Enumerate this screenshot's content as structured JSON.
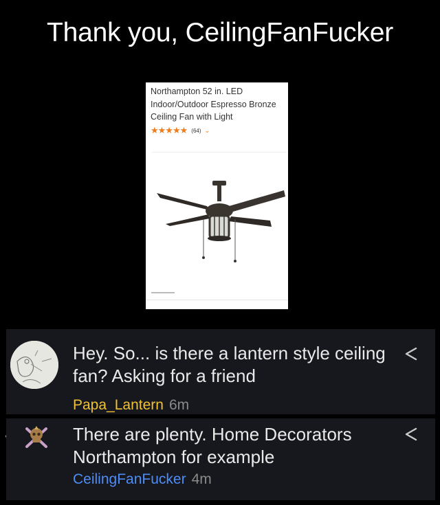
{
  "title": "Thank you, CeilingFanFucker",
  "product": {
    "title": "Northampton 52 in. LED Indoor/Outdoor Espresso Bronze Ceiling Fan with Light",
    "stars": "★★★★★",
    "rating_count": "(64)",
    "chevron": "⌄"
  },
  "comments": [
    {
      "text": "Hey. So... is there a lantern style ceiling fan? Asking for a friend",
      "user": "Papa_Lantern",
      "time": "6m"
    },
    {
      "text": "There are plenty. Home Decorators Northampton for example",
      "user": "CeilingFanFucker",
      "time": "4m"
    }
  ],
  "colors": {
    "username1": "#f1c232",
    "username2": "#4c8df6",
    "stars": "#f07c1a",
    "comment_bg": "#17181d"
  }
}
